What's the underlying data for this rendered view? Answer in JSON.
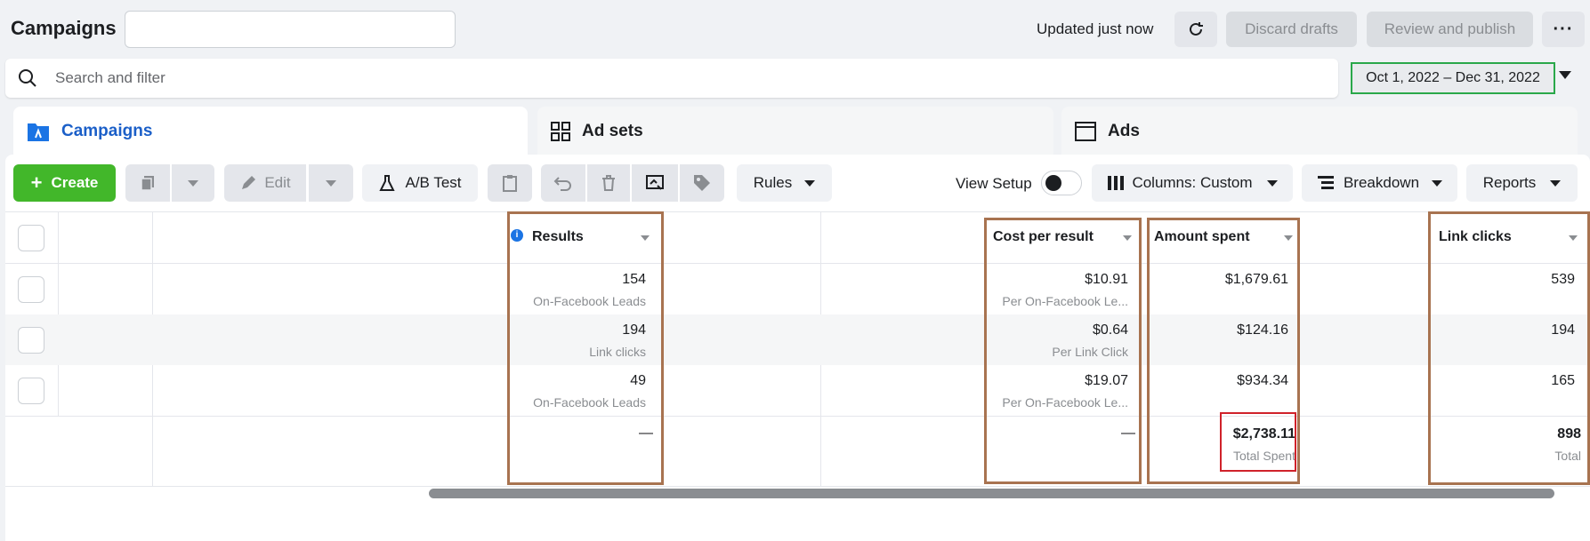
{
  "header": {
    "title": "Campaigns",
    "status": "Updated just now",
    "discard_label": "Discard drafts",
    "review_label": "Review and publish"
  },
  "search": {
    "placeholder": "Search and filter"
  },
  "date_range": "Oct 1, 2022 – Dec 31, 2022",
  "tabs": [
    {
      "label": "Campaigns",
      "active": true
    },
    {
      "label": "Ad sets",
      "active": false
    },
    {
      "label": "Ads",
      "active": false
    }
  ],
  "toolbar": {
    "create_label": "Create",
    "edit_label": "Edit",
    "ab_test_label": "A/B Test",
    "rules_label": "Rules",
    "view_setup_label": "View Setup",
    "columns_label": "Columns: Custom",
    "breakdown_label": "Breakdown",
    "reports_label": "Reports"
  },
  "columns": {
    "results": "Results",
    "cost_per_result": "Cost per result",
    "amount_spent": "Amount spent",
    "link_clicks": "Link clicks"
  },
  "rows": [
    {
      "results": "154",
      "results_sub": "On-Facebook Leads",
      "cpr": "$10.91",
      "cpr_sub": "Per On-Facebook Le...",
      "spent": "$1,679.61",
      "clicks": "539"
    },
    {
      "results": "194",
      "results_sub": "Link clicks",
      "cpr": "$0.64",
      "cpr_sub": "Per Link Click",
      "spent": "$124.16",
      "clicks": "194"
    },
    {
      "results": "49",
      "results_sub": "On-Facebook Leads",
      "cpr": "$19.07",
      "cpr_sub": "Per On-Facebook Le...",
      "spent": "$934.34",
      "clicks": "165"
    }
  ],
  "totals": {
    "results": "—",
    "cpr": "—",
    "spent": "$2,738.11",
    "spent_sub": "Total Spent",
    "clicks": "898",
    "clicks_sub": "Total"
  },
  "colors": {
    "accent": "#1b5fc8",
    "create_green": "#42b72a",
    "annotation_brown": "#a87350",
    "annotation_red": "#d0222a",
    "annotation_green": "#2aa84a"
  },
  "icons": {
    "search": "search-icon",
    "refresh": "refresh-icon",
    "more": "more-icon",
    "campaigns_tab": "campaigns-tab-icon",
    "adsets_tab": "adsets-grid-icon",
    "ads_tab": "ads-window-icon"
  }
}
